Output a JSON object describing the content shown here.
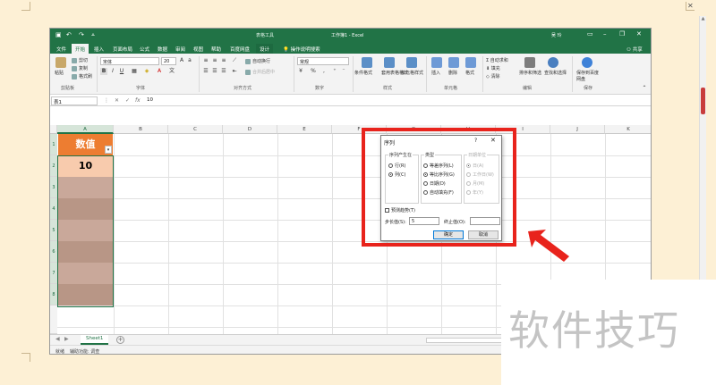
{
  "app": {
    "qat_icons": [
      "save-icon",
      "undo-icon",
      "redo-icon",
      "customize-icon"
    ],
    "context_group": "表格工具",
    "doc_title": "工作簿1 - Excel",
    "user": "吴 玲",
    "share": "共享",
    "accent": "#217346"
  },
  "tabs": [
    "文件",
    "开始",
    "插入",
    "页面布局",
    "公式",
    "数据",
    "审阅",
    "视图",
    "帮助",
    "百度网盘",
    "设计"
  ],
  "tell_me": "操作说明搜索",
  "ribbon": {
    "clipboard": {
      "label": "剪贴板",
      "paste": "粘贴",
      "cut": "剪切",
      "copy": "复制",
      "format_painter": "格式刷"
    },
    "font": {
      "label": "字体",
      "name": "宋体",
      "size": "20",
      "bold": "B",
      "italic": "I",
      "underline": "U"
    },
    "alignment": {
      "label": "对齐方式",
      "wrap": "自动换行",
      "merge": "合并后居中"
    },
    "number": {
      "label": "数字",
      "format": "常规",
      "currency": "¥",
      "percent": "%",
      "comma": ","
    },
    "styles": {
      "label": "样式",
      "conditional": "条件格式",
      "table": "套用表格格式",
      "cell_styles": "单元格样式"
    },
    "cells": {
      "label": "单元格",
      "insert": "插入",
      "delete": "删除",
      "format": "格式"
    },
    "editing": {
      "label": "编辑",
      "autosum": "自动求和",
      "fill": "填充",
      "clear": "清除",
      "sort": "排序和筛选",
      "find": "查找和选择"
    },
    "save": {
      "label": "保存",
      "button": "保存到百度网盘"
    }
  },
  "formula_bar": {
    "name_box": "表1",
    "fx": "fx",
    "value": "10"
  },
  "columns": [
    "A",
    "B",
    "C",
    "D",
    "E",
    "F",
    "G",
    "H",
    "I",
    "J",
    "K"
  ],
  "rows": [
    "1",
    "2",
    "3",
    "4",
    "5",
    "6",
    "7",
    "8"
  ],
  "cells": {
    "a1": "数值",
    "a2": "10"
  },
  "dialog": {
    "title": "序列",
    "help": "?",
    "close": "✕",
    "series_in": {
      "label": "序列产生在",
      "rows": "行(R)",
      "columns": "列(C)",
      "selected": "列(C)"
    },
    "type": {
      "label": "类型",
      "linear": "等差序列(L)",
      "growth": "等比序列(G)",
      "date": "日期(D)",
      "autofill": "自动填充(F)",
      "selected": "等比序列(G)"
    },
    "date_unit": {
      "label": "日期单位",
      "day": "日(A)",
      "weekday": "工作日(W)",
      "month": "月(M)",
      "year": "年(Y)"
    },
    "trend": "预测趋势(T)",
    "step_label": "步长值(S):",
    "step_value": "5",
    "stop_label": "终止值(O):",
    "stop_value": "",
    "ok": "确定",
    "cancel": "取消"
  },
  "sheets": [
    "Sheet1"
  ],
  "status": {
    "ready": "就绪",
    "accessibility": "辅助功能: 调查"
  },
  "annotation": {
    "highlight_color": "#e8231c"
  },
  "watermark": "软件技巧"
}
